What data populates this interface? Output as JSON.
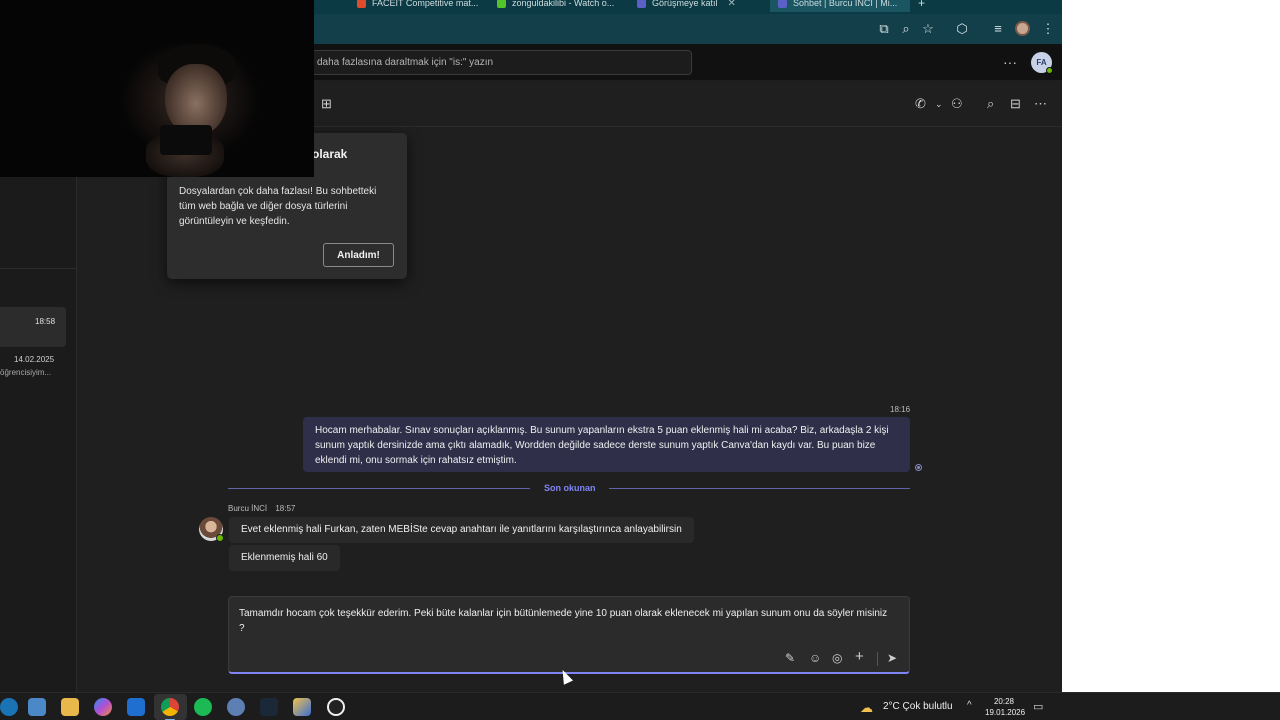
{
  "browser": {
    "tabs": [
      {
        "label": "FACEIT Competitive mat...",
        "color": "#e04b2a",
        "active": false
      },
      {
        "label": "zonguldakilibi - Watch o...",
        "color": "#53c22b",
        "active": false
      },
      {
        "label": "Görüşmeye katıl",
        "color": "#5b5fc7",
        "active": false
      },
      {
        "label": "Sohbet | Burcu İNCİ | Mi...",
        "color": "#5b5fc7",
        "active": true
      }
    ],
    "tab_close_glyph": "✕",
    "new_tab_glyph": "+"
  },
  "teams": {
    "search_placeholder": "daha fazlasına daraltmak için \"is:\" yazın",
    "more_glyph": "···",
    "user_initials": "FA",
    "chat_list": {
      "item1_time": "18:58",
      "item2_date": "14.02.2025",
      "item2_preview": "öğrencisiyim..."
    },
    "tooltip": {
      "title": "olarak",
      "body": "Dosyalardan çok daha fazlası! Bu sohbetteki tüm web bağla ve diğer dosya türlerini görüntüleyin ve keşfedin.",
      "button": "Anladım!"
    },
    "messages": {
      "my_time": "18:16",
      "my_text": "Hocam merhabalar. Sınav sonuçları açıklanmış. Bu sunum yapanların ekstra 5 puan eklenmiş hali mi acaba? Biz, arkadaşla 2 kişi sunum yaptık dersinizde ama çıktı alamadık, Wordden değilde sadece derste sunum yaptık Canva'dan kaydı var. Bu puan bize eklendi mi, onu sormak için rahatsız etmiştim.",
      "last_read_label": "Son okunan",
      "sender_name": "Burcu İNCİ",
      "sender_time": "18:57",
      "reply1": "Evet eklenmiş hali Furkan, zaten MEBİSte cevap anahtarı ile yanıtlarını karşılaştırınca anlayabilirsin",
      "reply2": "Eklenmemiş hali 60"
    },
    "composer": {
      "text": "Tamamdır hocam çok teşekkür ederim. Peki büte kalanlar için bütünlemede yine 10 puan olarak eklenecek mi yapılan sunum onu da söyler misiniz ?"
    }
  },
  "taskbar": {
    "weather_temp_label": "2°C  Çok bulutlu",
    "time": "20:28",
    "date": "19.01.2026",
    "tray_up_glyph": "^"
  },
  "colors": {
    "accent": "#7f85f5",
    "my_bubble": "#2f2f4a",
    "online": "#6bb700"
  }
}
